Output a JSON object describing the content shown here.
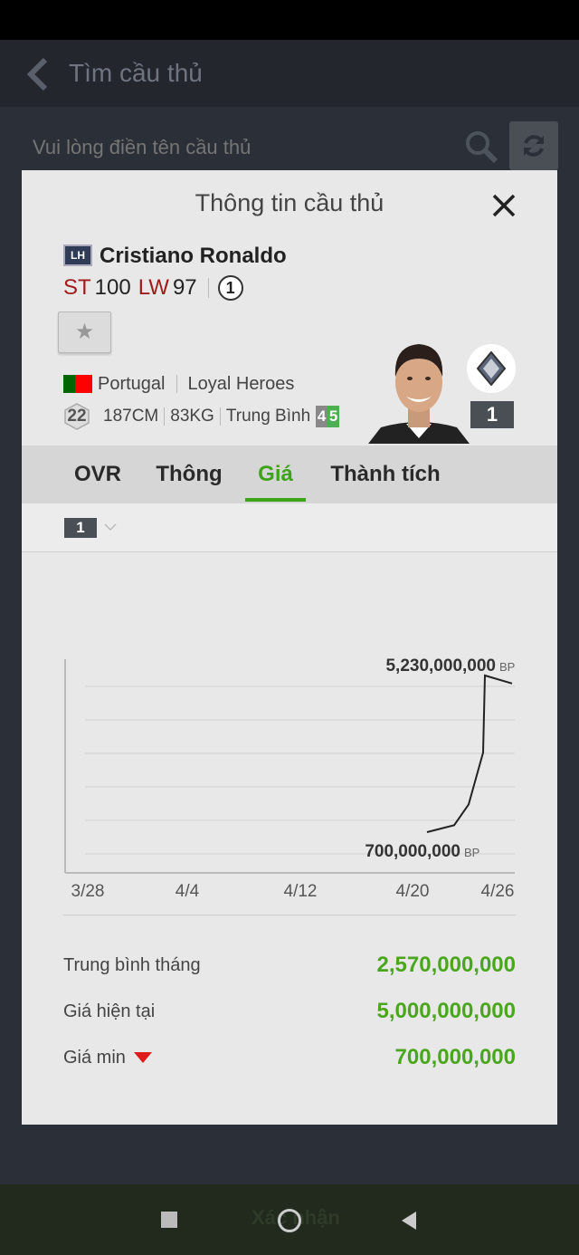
{
  "header": {
    "title": "Tìm cầu thủ"
  },
  "search": {
    "placeholder": "Vui lòng điền tên cầu thủ"
  },
  "modal": {
    "title": "Thông tin cầu thủ",
    "player": {
      "season": "LH",
      "name": "Cristiano Ronaldo",
      "positions": [
        {
          "pos": "ST",
          "ovr": "100"
        },
        {
          "pos": "LW",
          "ovr": "97"
        }
      ],
      "level": "1",
      "nation": "Portugal",
      "team": "Loyal Heroes",
      "age": "22",
      "height": "187CM",
      "weight": "83KG",
      "body_type": "Trung Bình",
      "skill_weak": "4",
      "skill_strong": "5",
      "enhance_level": "1"
    },
    "tabs": [
      {
        "label": "OVR"
      },
      {
        "label": "Thông tin"
      },
      {
        "label": "Giá"
      },
      {
        "label": "Thành tích CLB"
      }
    ],
    "filter_level": "1",
    "summary": {
      "avg_label": "Trung bình tháng",
      "avg_value": "2,570,000,000",
      "current_label": "Giá hiện tại",
      "current_value": "5,000,000,000",
      "min_label": "Giá min",
      "min_value": "700,000,000"
    }
  },
  "chart_data": {
    "type": "line",
    "x_ticks": [
      "3/28",
      "4/4",
      "4/12",
      "4/20",
      "4/26"
    ],
    "x": [
      "4/21",
      "4/23",
      "4/24",
      "4/25",
      "4/26",
      "4/27"
    ],
    "values": [
      700000000,
      900000000,
      1500000000,
      3000000000,
      5230000000,
      5000000000
    ],
    "max_label": "5,230,000,000",
    "min_label": "700,000,000",
    "unit": "BP",
    "grid": true
  },
  "nav": {
    "confirm_label": "Xác nhận"
  },
  "colors": {
    "accent": "#3fa31a",
    "position": "#a01c1c"
  }
}
